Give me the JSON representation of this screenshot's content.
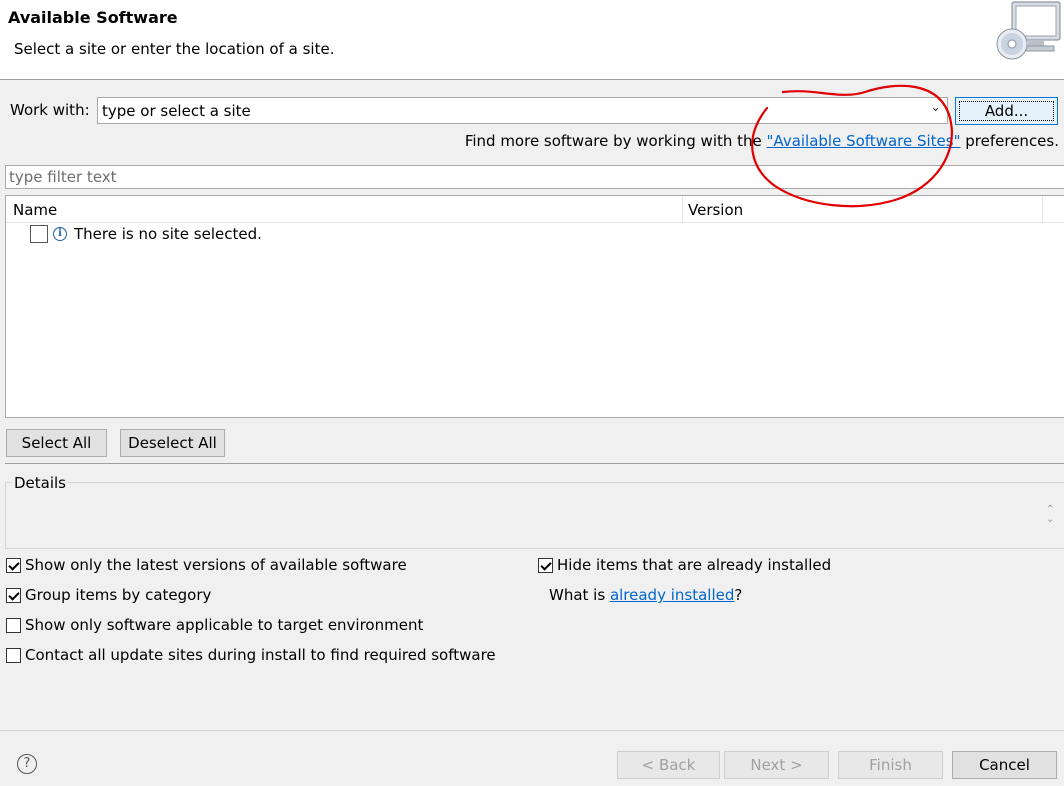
{
  "header": {
    "title": "Available Software",
    "subtitle": "Select a site or enter the location of a site.",
    "icon": "software-install-monitor-icon"
  },
  "work_with": {
    "label": "Work with:",
    "value": "type or select a site",
    "add_label": "Add..."
  },
  "find_more": {
    "prefix": "Find more software by working with the ",
    "link": "\"Available Software Sites\"",
    "suffix": " preferences."
  },
  "filter": {
    "placeholder": "type filter text"
  },
  "tree": {
    "columns": [
      "Name",
      "Version"
    ],
    "message": "There is no site selected."
  },
  "selection": {
    "select_all": "Select All",
    "deselect_all": "Deselect All"
  },
  "details": {
    "label": "Details"
  },
  "options": {
    "latest": {
      "label": "Show only the latest versions of available software",
      "checked": true
    },
    "group": {
      "label": "Group items by category",
      "checked": true
    },
    "applicable": {
      "label": "Show only software applicable to target environment",
      "checked": false
    },
    "contact": {
      "label": "Contact all update sites during install to find required software",
      "checked": false
    },
    "hide_installed": {
      "label": "Hide items that are already installed",
      "checked": true
    },
    "what_is": {
      "prefix": "What is ",
      "link": "already installed",
      "suffix": "?"
    }
  },
  "footer": {
    "back": "< Back",
    "next": "Next >",
    "finish": "Finish",
    "cancel": "Cancel"
  },
  "colors": {
    "link": "#0066cc",
    "annotation": "#e00000"
  }
}
